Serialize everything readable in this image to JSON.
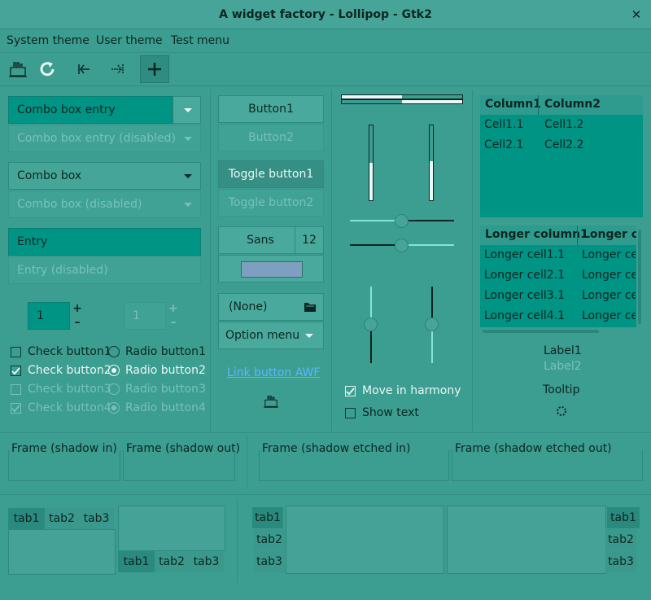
{
  "window": {
    "title": "A widget factory - Lollipop - Gtk2"
  },
  "menu": {
    "items": [
      "System theme",
      "User theme",
      "Test menu"
    ]
  },
  "toolbar": {
    "icons": [
      "factory-icon",
      "refresh-icon",
      "go-first-icon",
      "go-last-icon",
      "add-icon"
    ]
  },
  "combos": {
    "entry": "Combo box entry",
    "entry_disabled": "Combo box entry (disabled)",
    "box": "Combo box",
    "box_disabled": "Combo box (disabled)"
  },
  "entries": {
    "entry": "Entry",
    "entry_disabled": "Entry (disabled)"
  },
  "spin": {
    "value1": "1",
    "value2": "1"
  },
  "checks": {
    "c1": "Check button1",
    "c2": "Check button2",
    "c3": "Check button3",
    "c4": "Check button4",
    "r1": "Radio button1",
    "r2": "Radio button2",
    "r3": "Radio button3",
    "r4": "Radio button4"
  },
  "buttons": {
    "b1": "Button1",
    "b2": "Button2",
    "t1": "Toggle button1",
    "t2": "Toggle button2",
    "font": "Sans",
    "font_size": "12",
    "file": "(None)",
    "option": "Option menu",
    "link": "Link button AWF"
  },
  "scales": {
    "move_harmony": "Move in harmony",
    "show_text": "Show text"
  },
  "colors": {
    "accent": "#009485",
    "bg": "#3c9d91",
    "color_button": "#7e9fc0"
  },
  "tree1": {
    "headers": [
      "Column1",
      "Column2"
    ],
    "rows": [
      [
        "Cell1.1",
        "Cell1.2"
      ],
      [
        "Cell2.1",
        "Cell2.2"
      ]
    ]
  },
  "tree2": {
    "headers": [
      "Longer column1",
      "Longer co"
    ],
    "rows": [
      [
        "Longer cell1.1",
        "Longer ce"
      ],
      [
        "Longer cell2.1",
        "Longer ce"
      ],
      [
        "Longer cell3.1",
        "Longer ce"
      ],
      [
        "Longer cell4.1",
        "Longer ce"
      ]
    ]
  },
  "labels": {
    "label1": "Label1",
    "label2": "Label2",
    "tooltip": "Tooltip"
  },
  "frames": {
    "in": "Frame (shadow in)",
    "out": "Frame (shadow out)",
    "etched_in": "Frame (shadow etched in)",
    "etched_out": "Frame (shadow etched out)"
  },
  "tabs": {
    "t1": "tab1",
    "t2": "tab2",
    "t3": "tab3"
  }
}
